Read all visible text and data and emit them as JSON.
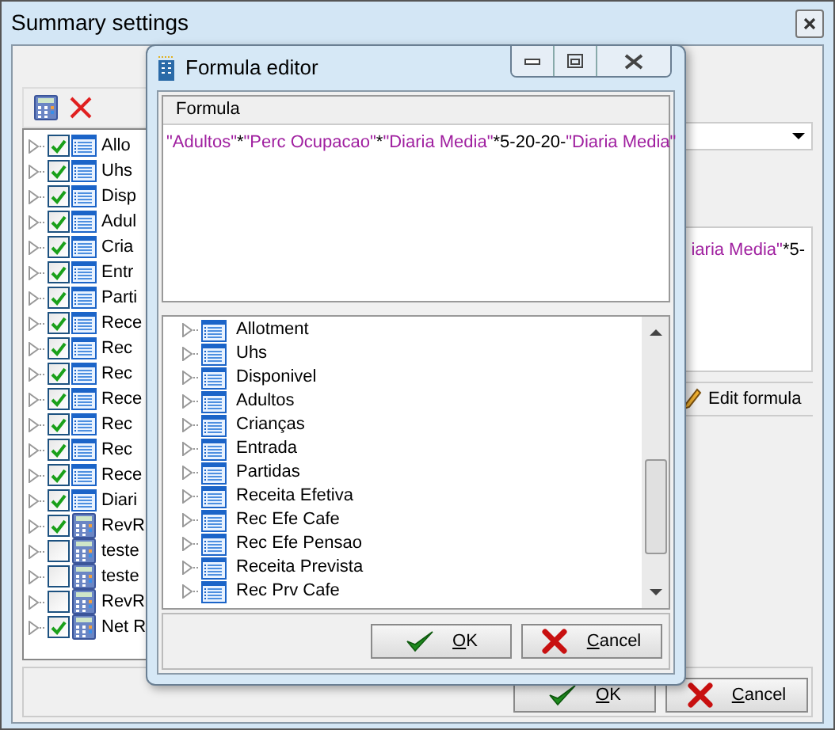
{
  "window": {
    "title": "Summary settings"
  },
  "fields_tree": [
    {
      "label": "Allo",
      "checked": true,
      "kind": "list"
    },
    {
      "label": "Uhs",
      "checked": true,
      "kind": "list"
    },
    {
      "label": "Disp",
      "checked": true,
      "kind": "list"
    },
    {
      "label": "Adul",
      "checked": true,
      "kind": "list"
    },
    {
      "label": "Cria",
      "checked": true,
      "kind": "list"
    },
    {
      "label": "Entr",
      "checked": true,
      "kind": "list"
    },
    {
      "label": "Parti",
      "checked": true,
      "kind": "list"
    },
    {
      "label": "Rece",
      "checked": true,
      "kind": "list"
    },
    {
      "label": "Rec",
      "checked": true,
      "kind": "list"
    },
    {
      "label": "Rec",
      "checked": true,
      "kind": "list"
    },
    {
      "label": "Rece",
      "checked": true,
      "kind": "list"
    },
    {
      "label": "Rec",
      "checked": true,
      "kind": "list"
    },
    {
      "label": "Rec",
      "checked": true,
      "kind": "list"
    },
    {
      "label": "Rece",
      "checked": true,
      "kind": "list"
    },
    {
      "label": "Diari",
      "checked": true,
      "kind": "list"
    },
    {
      "label": "RevR",
      "checked": true,
      "kind": "calc"
    },
    {
      "label": "teste",
      "checked": false,
      "kind": "calc"
    },
    {
      "label": "teste",
      "checked": false,
      "kind": "calc"
    },
    {
      "label": "RevR",
      "checked": false,
      "kind": "calc"
    },
    {
      "label": "Net R",
      "checked": true,
      "kind": "calc"
    }
  ],
  "formula_preview": [
    {
      "kind": "field",
      "text": "iaria Media\""
    },
    {
      "kind": "op",
      "text": "*5-"
    }
  ],
  "edit_formula_button": "Edit formula",
  "buttons": [
    {
      "label": "OK",
      "kind": "ok"
    },
    {
      "label": "Cancel",
      "kind": "cancel"
    }
  ],
  "dialog": {
    "title": "Formula editor",
    "formula_header": "Formula",
    "formula": [
      {
        "kind": "field",
        "text": "\"Adultos\""
      },
      {
        "kind": "op",
        "text": "*"
      },
      {
        "kind": "field",
        "text": "\"Perc Ocupacao\""
      },
      {
        "kind": "op",
        "text": "*"
      },
      {
        "kind": "field",
        "text": "\"Diaria Media\""
      },
      {
        "kind": "op",
        "text": "*5-20-20-"
      },
      {
        "kind": "field",
        "text": "\"Diaria Media\""
      }
    ],
    "items": [
      "Allotment",
      "Uhs",
      "Disponivel",
      "Adultos",
      "Crianças",
      "Entrada",
      "Partidas",
      "Receita Efetiva",
      "Rec Efe Cafe",
      "Rec Efe Pensao",
      "Receita Prevista",
      "Rec Prv Cafe"
    ],
    "buttons": [
      {
        "label": "OK",
        "kind": "ok"
      },
      {
        "label": "Cancel",
        "kind": "cancel"
      }
    ]
  }
}
